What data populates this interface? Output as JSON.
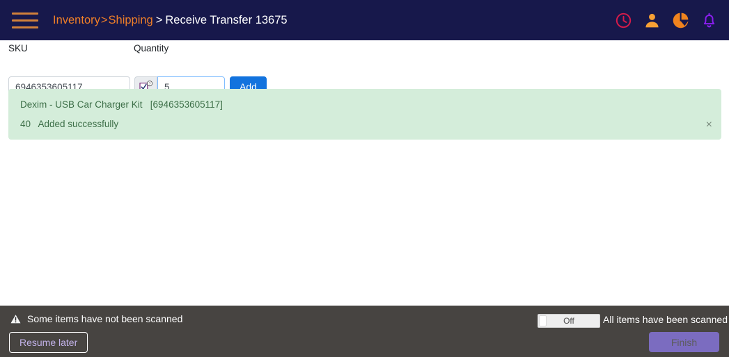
{
  "header": {
    "menu_icon": "hamburger-icon",
    "breadcrumb": {
      "item1": "Inventory",
      "sep1": ">",
      "item2": "Shipping",
      "sep2": ">",
      "current": "Receive Transfer 13675"
    },
    "icons": [
      {
        "name": "clock-icon",
        "color": "#d81b4a"
      },
      {
        "name": "user-icon",
        "color": "#f7a034"
      },
      {
        "name": "pie-chart-icon",
        "color": "#f0831e"
      },
      {
        "name": "bell-icon",
        "color": "#8b1ef0"
      }
    ],
    "background": "#17184b"
  },
  "form": {
    "sku_label": "SKU",
    "sku_value": "6946353605117",
    "sku_placeholder": "",
    "quantity_label": "Quantity",
    "quantity_value": "5",
    "quantity_placeholder": "",
    "checkbox_icon": "checkbox-help-icon",
    "add_label": "Add",
    "add_color": "#1273de"
  },
  "alert": {
    "product_name": "Dexim - USB Car Charger Kit",
    "product_sku": "[6946353605117]",
    "line1": "Dexim - USB Car Charger Kit   [6946353605117]",
    "quantity": "40",
    "status": "Added successfully",
    "line2": "40   Added successfully",
    "close_label": "×",
    "background": "#d4edda",
    "text_color": "#3c6e47"
  },
  "footer": {
    "warning_icon": "warning-triangle-icon",
    "warning_text": "Some items have not been scanned",
    "resume_label": "Resume later",
    "toggle": {
      "state_label": "Off",
      "checked": false
    },
    "scanned_text": "All items have been scanned",
    "finish_label": "Finish",
    "finish_color": "#7b6cc0",
    "background": "#474441"
  }
}
